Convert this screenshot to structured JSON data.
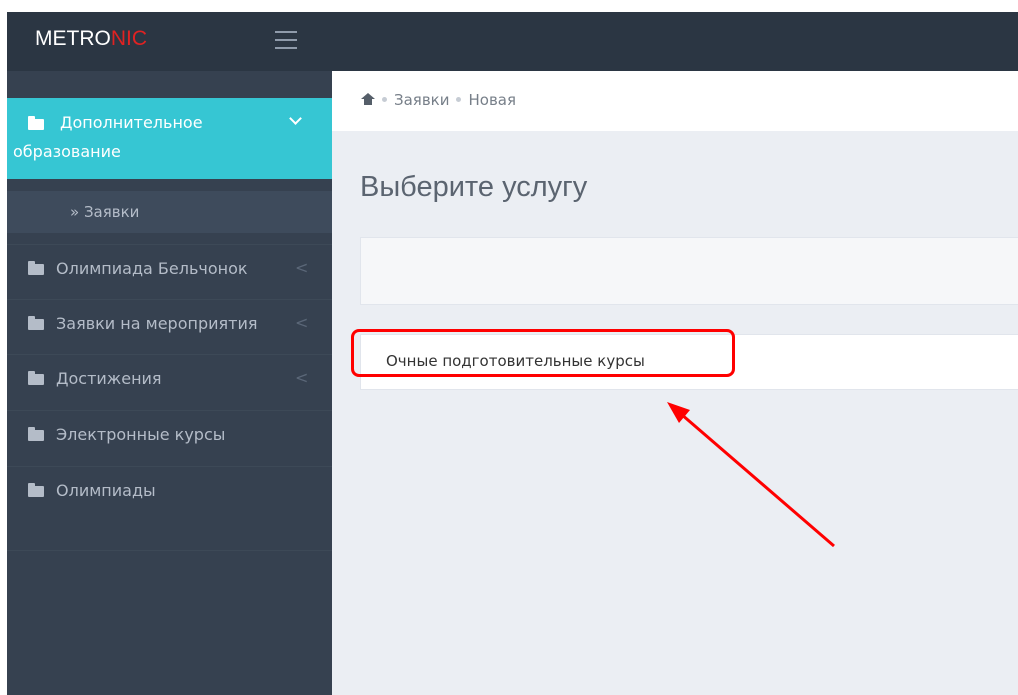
{
  "brand": {
    "prefix": "METRO",
    "accent": "NIC",
    "accent_color": "#e02222"
  },
  "sidebar": {
    "active": {
      "line1": "Дополнительное",
      "line2": "образование"
    },
    "sub_item": "» Заявки",
    "items": [
      {
        "label": "Олимпиада Бельчонок",
        "chevron": "<"
      },
      {
        "label": "Заявки на мероприятия",
        "chevron": "<"
      },
      {
        "label": "Достижения",
        "chevron": "<"
      },
      {
        "label": "Электронные курсы"
      },
      {
        "label": "Олимпиады"
      }
    ]
  },
  "breadcrumb": [
    "Заявки",
    "Новая"
  ],
  "main": {
    "title": "Выберите услугу",
    "services": [
      "Очные подготовительные курсы"
    ]
  },
  "colors": {
    "topbar": "#2b3643",
    "sidebar": "#364150",
    "active": "#36c6d3",
    "annotation": "#ff0000"
  }
}
